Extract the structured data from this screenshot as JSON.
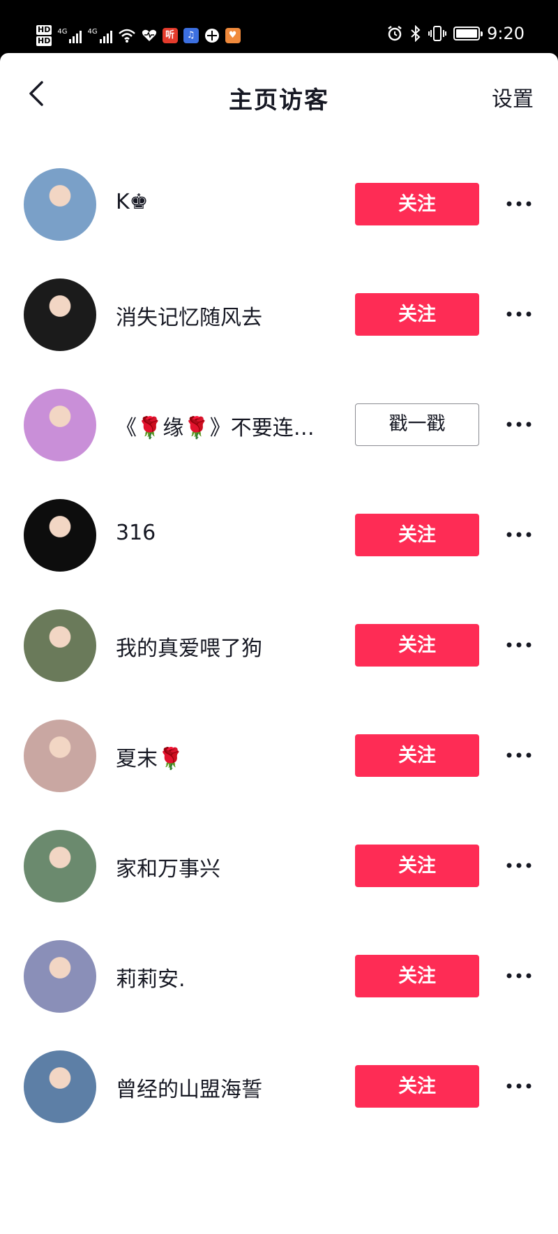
{
  "status_bar": {
    "time": "9:20",
    "hd_labels": [
      "HD",
      "HD"
    ],
    "network_labels": [
      "4G",
      "4G"
    ],
    "app_icon_text": "听"
  },
  "header": {
    "title": "主页访客",
    "settings_label": "设置"
  },
  "visitors": [
    {
      "name": "K♚",
      "button": "关注",
      "style": "primary",
      "avatar_color": "#7aa0c8"
    },
    {
      "name": "消失记忆随风去",
      "button": "关注",
      "style": "primary",
      "avatar_color": "#1b1b1b"
    },
    {
      "name": "《🌹缘🌹》不要连…",
      "button": "戳一戳",
      "style": "secondary",
      "avatar_color": "#c98fd8"
    },
    {
      "name": "316",
      "button": "关注",
      "style": "primary",
      "avatar_color": "#0d0d0d"
    },
    {
      "name": "我的真爱喂了狗",
      "button": "关注",
      "style": "primary",
      "avatar_color": "#6a7a5a"
    },
    {
      "name": "夏末🌹",
      "button": "关注",
      "style": "primary",
      "avatar_color": "#c9a7a2"
    },
    {
      "name": "家和万事兴",
      "button": "关注",
      "style": "primary",
      "avatar_color": "#6b8a6e"
    },
    {
      "name": "莉莉安.",
      "button": "关注",
      "style": "primary",
      "avatar_color": "#8a8fb8"
    },
    {
      "name": "曾经的山盟海誓",
      "button": "关注",
      "style": "primary",
      "avatar_color": "#5d7fa6"
    }
  ],
  "colors": {
    "accent": "#fe2c55",
    "text": "#161823"
  }
}
